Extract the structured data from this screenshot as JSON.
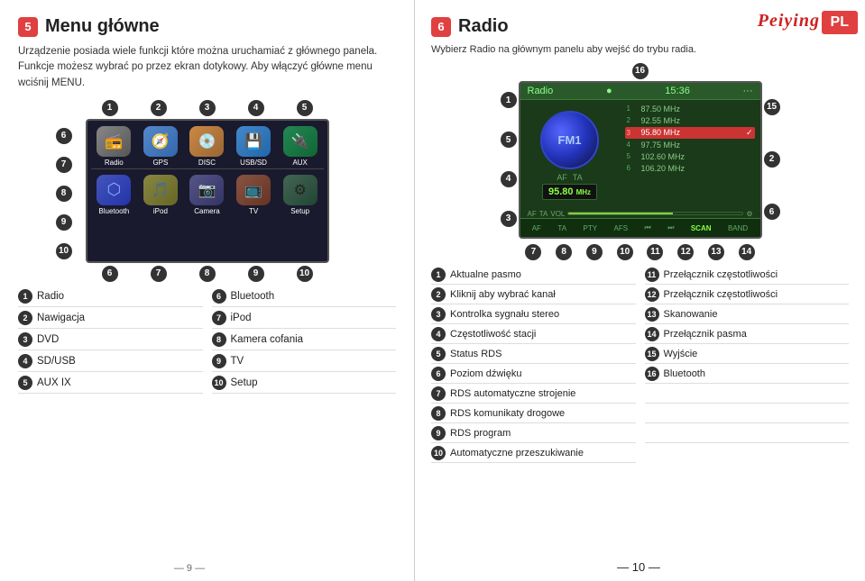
{
  "left": {
    "section_num": "5",
    "section_title": "Menu główne",
    "intro_line1": "Urządzenie posiada wiele funkcji które można uruchamiać z głównego panela.",
    "intro_line2": "Funkcje możesz wybrać po przez ekran dotykowy. Aby włączyć główne menu wciśnij MENU.",
    "screen_top_nums": [
      "1",
      "2",
      "3",
      "4",
      "5"
    ],
    "screen_bottom_nums": [
      "6",
      "7",
      "8",
      "9",
      "10"
    ],
    "app_icons": [
      {
        "label": "Radio",
        "icon": "📻",
        "class": "ic-radio"
      },
      {
        "label": "GPS",
        "icon": "🧭",
        "class": "ic-gps"
      },
      {
        "label": "DISC",
        "icon": "💿",
        "class": "ic-disc"
      },
      {
        "label": "USB/SD",
        "icon": "💾",
        "class": "ic-usb"
      },
      {
        "label": "AUX",
        "icon": "🔌",
        "class": "ic-aux"
      },
      {
        "label": "Bluetooth",
        "icon": "⬡",
        "class": "ic-bluetooth"
      },
      {
        "label": "iPod",
        "icon": "🎵",
        "class": "ic-ipod"
      },
      {
        "label": "Camera",
        "icon": "📷",
        "class": "ic-camera"
      },
      {
        "label": "TV",
        "icon": "📺",
        "class": "ic-tv"
      },
      {
        "label": "Setup",
        "icon": "⚙",
        "class": "ic-setup"
      }
    ],
    "legend": [
      {
        "num": "1",
        "label": "Radio"
      },
      {
        "num": "6",
        "label": "Bluetooth"
      },
      {
        "num": "2",
        "label": "Nawigacja"
      },
      {
        "num": "7",
        "label": "iPod"
      },
      {
        "num": "3",
        "label": "DVD"
      },
      {
        "num": "8",
        "label": "Kamera cofania"
      },
      {
        "num": "4",
        "label": "SD/USB"
      },
      {
        "num": "9",
        "label": "TV"
      },
      {
        "num": "5",
        "label": "AUX IX"
      },
      {
        "num": "10",
        "label": "Setup"
      }
    ],
    "footer": "— 9 —"
  },
  "right": {
    "section_num": "6",
    "section_title": "Radio",
    "intro": "Wybierz Radio na głównym panelu aby wejść do trybu radia.",
    "pl_badge": "PL",
    "peiying_logo": "Peiying",
    "radio_screen": {
      "title": "Radio",
      "time": "15:36",
      "station": "FM1",
      "af": "AF",
      "ta": "TA",
      "freq_display": "95.80 MHz",
      "freq_list": [
        {
          "num": "1",
          "freq": "87.50 MHz",
          "active": false
        },
        {
          "num": "2",
          "freq": "92.55 MHz",
          "active": false
        },
        {
          "num": "3",
          "freq": "95.80 MHz",
          "active": true
        },
        {
          "num": "4",
          "freq": "97.75 MHz",
          "active": false
        },
        {
          "num": "5",
          "freq": "102.60 MHz",
          "active": false
        },
        {
          "num": "6",
          "freq": "106.20 MHz",
          "active": false
        }
      ],
      "bottom_buttons": [
        "AF",
        "TA",
        "PTY",
        "AFS",
        "⏮",
        "⏭",
        "SCAN",
        "BAND"
      ]
    },
    "anno_nums_top": [
      "16"
    ],
    "anno_num_15": "15",
    "left_side_nums": [
      "1",
      "5",
      "4",
      "3"
    ],
    "right_side_nums": [
      "2",
      "6"
    ],
    "bottom_nums": [
      "7",
      "8",
      "9",
      "10",
      "11",
      "12",
      "13",
      "14"
    ],
    "features": [
      {
        "num": "1",
        "label": "Aktualne pasmo"
      },
      {
        "num": "11",
        "label": "Przełącznik częstotliwości"
      },
      {
        "num": "2",
        "label": "Kliknij aby wybrać kanał"
      },
      {
        "num": "12",
        "label": "Przełącznik częstotliwości"
      },
      {
        "num": "3",
        "label": "Kontrolka sygnału stereo"
      },
      {
        "num": "13",
        "label": "Skanowanie"
      },
      {
        "num": "4",
        "label": "Częstotliwość stacji"
      },
      {
        "num": "14",
        "label": "Przełącznik pasma"
      },
      {
        "num": "5",
        "label": "Status RDS"
      },
      {
        "num": "6",
        "label": "Poziom dźwięku"
      },
      {
        "num": "15",
        "label": "Wyjście"
      },
      {
        "num": "7",
        "label": "RDS automatyczne strojenie"
      },
      {
        "num": "8",
        "label": "RDS komunikaty drogowe"
      },
      {
        "num": "16",
        "label": "Bluetooth"
      },
      {
        "num": "9",
        "label": "RDS program"
      },
      {
        "num": "10",
        "label": "Automatyczne przeszukiwanie"
      }
    ],
    "footer": "— 10 —"
  }
}
